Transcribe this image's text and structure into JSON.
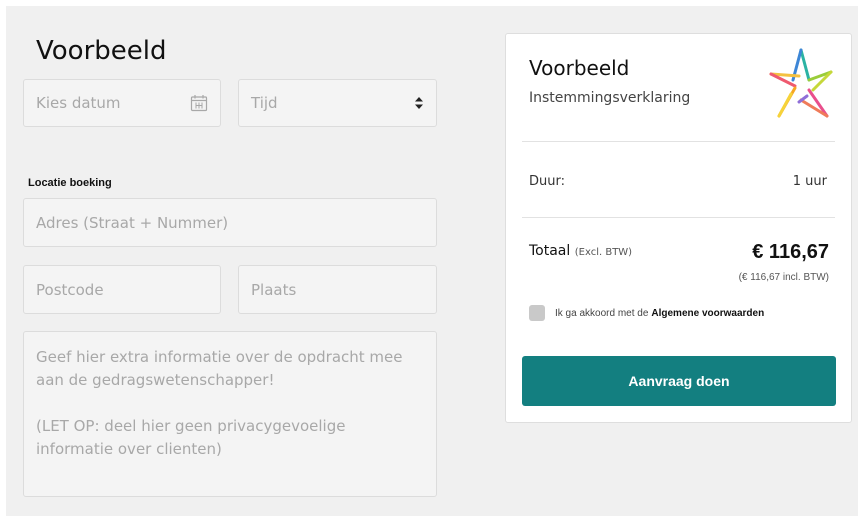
{
  "form": {
    "title": "Voorbeeld",
    "date_placeholder": "Kies datum",
    "time_placeholder": "Tijd",
    "location_label": "Locatie boeking",
    "address_placeholder": "Adres (Straat + Nummer)",
    "postcode_placeholder": "Postcode",
    "city_placeholder": "Plaats",
    "notes_placeholder_1": "Geef hier extra informatie over de opdracht mee aan de gedragswetenschapper!",
    "notes_placeholder_2": "(LET OP: deel hier geen privacygevoelige informatie over clienten)",
    "icons": {
      "date": "calendar-icon",
      "time": "select-arrows-icon"
    }
  },
  "summary": {
    "title": "Voorbeeld",
    "subtitle": "Instemmingsverklaring",
    "duration_label": "Duur:",
    "duration_value": "1 uur",
    "total_label": "Totaal",
    "total_note": "(Excl. BTW)",
    "total_value": "€ 116,67",
    "total_incl": "(€ 116,67 incl. BTW)",
    "agree_text": "Ik ga akkoord met de",
    "agree_link": "Algemene voorwaarden",
    "cta_label": "Aanvraag doen",
    "logo_icon": "star-logo-icon"
  },
  "colors": {
    "accent": "#137f80",
    "background": "#f0f0f0",
    "card": "#ffffff"
  }
}
